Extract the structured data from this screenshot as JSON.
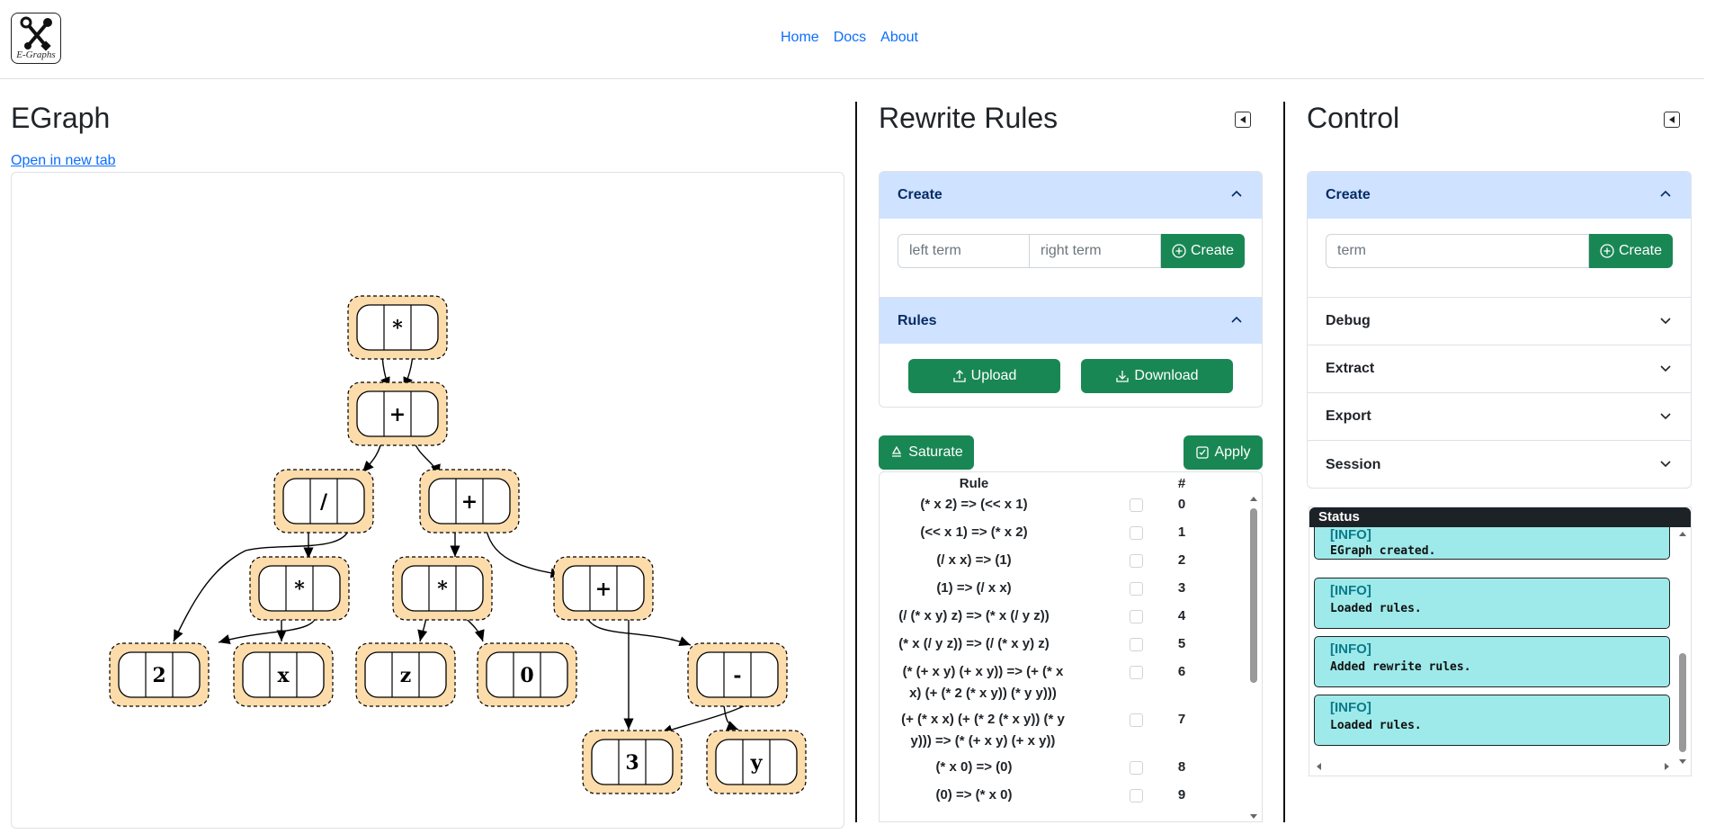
{
  "header": {
    "logo_text": "E-Graphs",
    "logo_icon": "tools-icon",
    "nav": [
      "Home",
      "Docs",
      "About"
    ]
  },
  "egraph": {
    "title": "EGraph",
    "open_link": "Open in new tab",
    "nodes": [
      "*",
      "+",
      "/",
      "+",
      "*",
      "*",
      "+",
      "2",
      "x",
      "z",
      "0",
      "-",
      "3",
      "y"
    ]
  },
  "rewrite": {
    "title": "Rewrite Rules",
    "create": {
      "header": "Create",
      "left_placeholder": "left term",
      "right_placeholder": "right term",
      "button": "Create"
    },
    "rules_section": {
      "header": "Rules",
      "upload": "Upload",
      "download": "Download"
    },
    "saturate": "Saturate",
    "apply": "Apply",
    "table": {
      "col_rule": "Rule",
      "col_num": "#",
      "rows": [
        {
          "rule": "(* x 2) => (<< x 1)",
          "num": "0"
        },
        {
          "rule": "(<< x 1) => (* x 2)",
          "num": "1"
        },
        {
          "rule": "(/ x x) => (1)",
          "num": "2"
        },
        {
          "rule": "(1) => (/ x x)",
          "num": "3"
        },
        {
          "rule": "(/ (* x y) z) => (* x (/ y z))",
          "num": "4"
        },
        {
          "rule": "(* x (/ y z)) => (/ (* x y) z)",
          "num": "5"
        },
        {
          "rule_line1": "(* (+ x y) (+ x y)) => (+ (* x",
          "rule_line2": "x) (+ (* 2 (* x y)) (* y y)))",
          "num": "6"
        },
        {
          "rule_line1": "(+ (* x x) (+ (* 2 (* x y)) (* y",
          "rule_line2": "y))) => (* (+ x y) (+ x y))",
          "num": "7"
        },
        {
          "rule": "(* x 0) => (0)",
          "num": "8"
        },
        {
          "rule": "(0) => (* x 0)",
          "num": "9"
        }
      ]
    }
  },
  "control": {
    "title": "Control",
    "create": {
      "header": "Create",
      "placeholder": "term",
      "button": "Create"
    },
    "sections": [
      "Debug",
      "Extract",
      "Export",
      "Session"
    ],
    "status": {
      "header": "Status",
      "logs": [
        {
          "level": "[INFO]",
          "msg": "EGraph created."
        },
        {
          "level": "[INFO]",
          "msg": "Loaded rules."
        },
        {
          "level": "[INFO]",
          "msg": "Added rewrite rules."
        },
        {
          "level": "[INFO]",
          "msg": "Loaded rules."
        }
      ]
    }
  },
  "colors": {
    "accent_green": "#198754",
    "link_blue": "#0d6efd",
    "accordion_open": "#cfe2ff",
    "node_fill": "#fcdcaa",
    "log_bg": "#9eeaea"
  }
}
